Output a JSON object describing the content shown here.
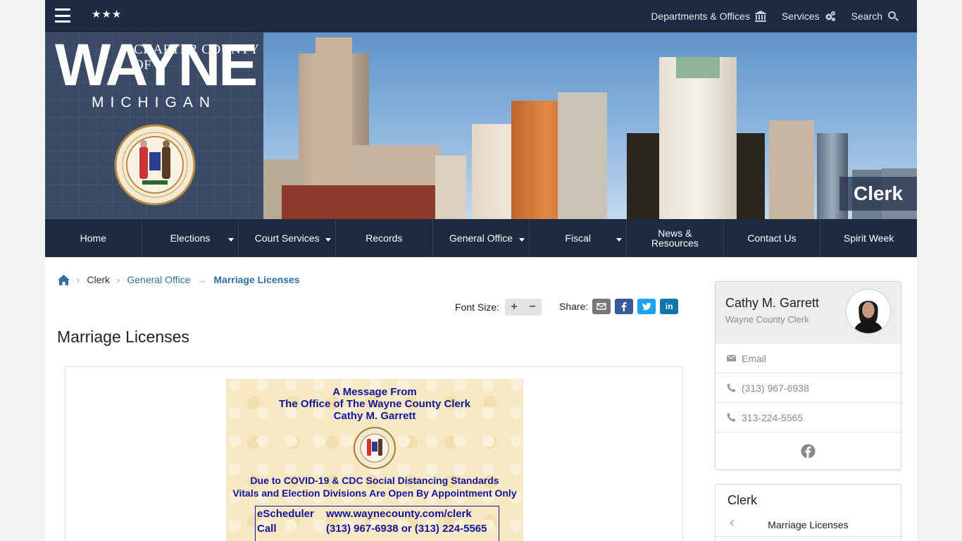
{
  "topbar": {
    "stars": "★★★",
    "links": [
      {
        "label": "Departments & Offices",
        "icon": "building-icon"
      },
      {
        "label": "Services",
        "icon": "gears-icon"
      },
      {
        "label": "Search",
        "icon": "search-icon"
      }
    ]
  },
  "brand": {
    "charter": "CHARTER COUNTY OF",
    "wayne": "WAYNE",
    "michigan": "MICHIGAN"
  },
  "banner": {
    "page_tag": "Clerk"
  },
  "mainnav": {
    "items": [
      {
        "label": "Home"
      },
      {
        "label": "Elections"
      },
      {
        "label": "Court Services"
      },
      {
        "label": "Records"
      },
      {
        "label": "General Office"
      },
      {
        "label": "Fiscal"
      },
      {
        "label": "News & Resources"
      },
      {
        "label": "Contact Us"
      },
      {
        "label": "Spirit Week"
      }
    ]
  },
  "breadcrumb": {
    "items": [
      "Clerk",
      "General Office",
      "Marriage Licenses"
    ]
  },
  "tools": {
    "font_size_label": "Font Size:",
    "plus": "+",
    "minus": "−",
    "share_label": "Share:",
    "linkedin": "in"
  },
  "page": {
    "title": "Marriage Licenses"
  },
  "flyer": {
    "line1": "A Message From",
    "line2": "The Office of The Wayne County Clerk",
    "line3": "Cathy M. Garrett",
    "notice1": "Due to COVID-19 & CDC Social Distancing Standards",
    "notice2": "Vitals and Election Divisions Are Open By Appointment Only",
    "rows": [
      {
        "k": "eScheduler",
        "v": "www.waynecounty.com/clerk"
      },
      {
        "k": "Call",
        "v": "(313) 967-6938 or (313) 224-5565"
      }
    ]
  },
  "contact": {
    "name": "Cathy M. Garrett",
    "role": "Wayne County Clerk",
    "email_label": "Email",
    "phone1": "(313) 967-6938",
    "phone2": "313-224-5565"
  },
  "subnav": {
    "title": "Clerk",
    "item": "Marriage Licenses"
  },
  "colors": {
    "navy": "#1f2940",
    "link": "#2f6fa7",
    "flyer_text": "#13149a",
    "facebook": "#3b5998",
    "twitter": "#1da1f2",
    "linkedin": "#0e76a8"
  }
}
